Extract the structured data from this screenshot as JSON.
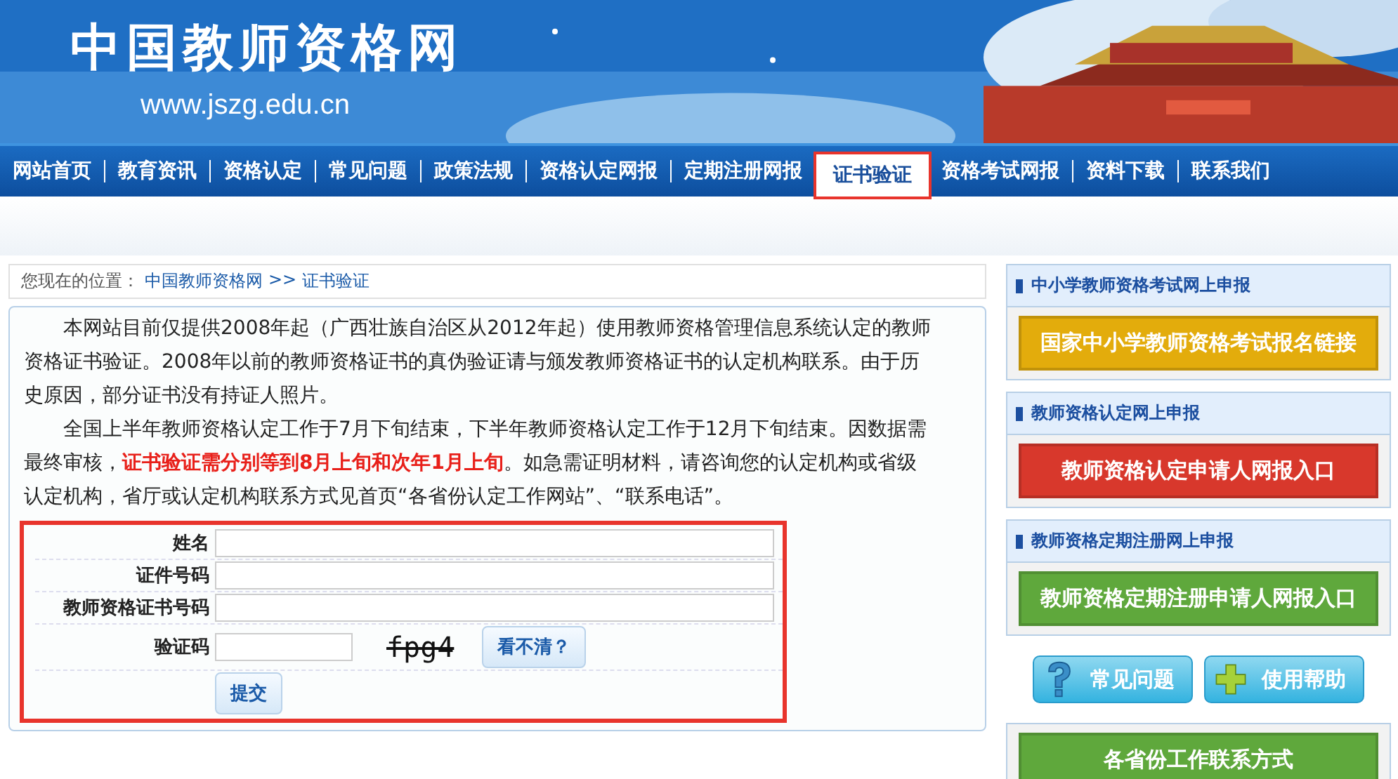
{
  "header": {
    "logo": "中国教师资格网",
    "url": "www.jszg.edu.cn"
  },
  "nav": [
    {
      "label": "网站首页",
      "selected": false
    },
    {
      "label": "教育资讯",
      "selected": false
    },
    {
      "label": "资格认定",
      "selected": false
    },
    {
      "label": "常见问题",
      "selected": false
    },
    {
      "label": "政策法规",
      "selected": false
    },
    {
      "label": "资格认定网报",
      "selected": false
    },
    {
      "label": "定期注册网报",
      "selected": false
    },
    {
      "label": "证书验证",
      "selected": true
    },
    {
      "label": "资格考试网报",
      "selected": false
    },
    {
      "label": "资料下载",
      "selected": false
    },
    {
      "label": "联系我们",
      "selected": false
    }
  ],
  "breadcrumb": {
    "label": "您现在的位置：",
    "links": [
      "中国教师资格网",
      "证书验证"
    ],
    "separator": ">>"
  },
  "notice": {
    "paragraphs": [
      "本网站目前仅提供2008年起（广西壮族自治区从2012年起）使用教师资格管理信息系统认定的教师资格证书验证。2008年以前的教师资格证书的真伪验证请与颁发教师资格证书的认定机构联系。由于历史原因，部分证书没有持证人照片。",
      "全国上半年教师资格认定工作于7月下旬结束，下半年教师资格认定工作于12月下旬结束。因数据需最终审核，**证书验证需分别等到8月上旬和次年1月上旬**。如急需证明材料，请咨询您的认定机构或省级认定机构，省厅或认定机构联系方式见首页“各省份认定工作网站”、“联系电话”。"
    ]
  },
  "form": {
    "highlighted": true,
    "fields": [
      {
        "kind": "text",
        "label": "姓名"
      },
      {
        "kind": "text",
        "label": "证件号码"
      },
      {
        "kind": "text",
        "label": "教师资格证书号码"
      },
      {
        "kind": "captcha",
        "label": "验证码",
        "captcha": "fpg4",
        "refresh": "看不清？"
      }
    ],
    "submit": "提交"
  },
  "sidebar": [
    {
      "kind": "panel",
      "title": "中小学教师资格考试网上申报",
      "button": {
        "label": "国家中小学教师资格考试报名链接",
        "color": "#e3ac0c"
      }
    },
    {
      "kind": "panel",
      "title": "教师资格认定网上申报",
      "button": {
        "label": "教师资格认定申请人网报入口",
        "color": "#d8382c"
      }
    },
    {
      "kind": "panel",
      "title": "教师资格定期注册网上申报",
      "button": {
        "label": "教师资格定期注册申请人网报入口",
        "color": "#5fa83c"
      }
    },
    {
      "kind": "shortcuts",
      "buttons": [
        {
          "label": "常见问题"
        },
        {
          "label": "使用帮助"
        }
      ]
    },
    {
      "kind": "banner",
      "button": {
        "label": "各省份工作联系方式",
        "color": "#5fa83c"
      }
    }
  ]
}
